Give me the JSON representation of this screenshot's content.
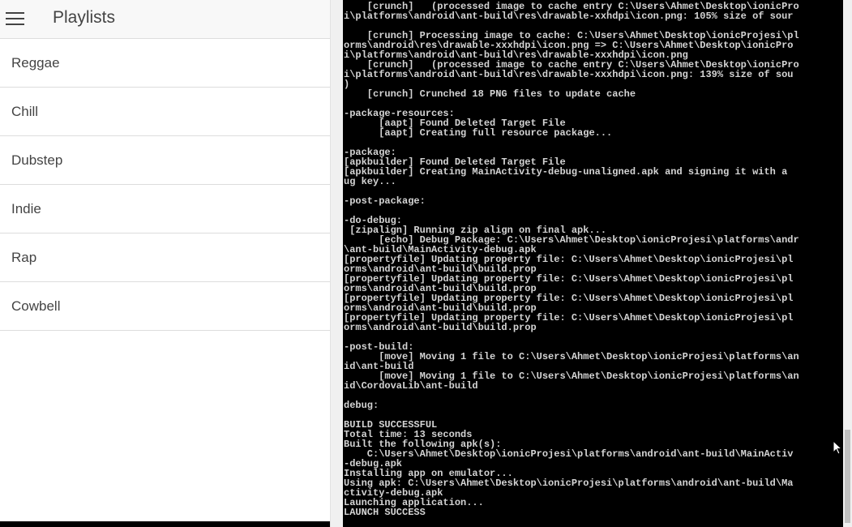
{
  "app": {
    "title": "Playlists",
    "menu_icon": "hamburger-menu-icon",
    "playlists": [
      {
        "label": "Reggae"
      },
      {
        "label": "Chill"
      },
      {
        "label": "Dubstep"
      },
      {
        "label": "Indie"
      },
      {
        "label": "Rap"
      },
      {
        "label": "Cowbell"
      }
    ]
  },
  "console": {
    "lines": [
      "    [crunch]   (processed image to cache entry C:\\Users\\Ahmet\\Desktop\\ionicPro",
      "i\\platforms\\android\\ant-build\\res\\drawable-xxhdpi\\icon.png: 105% size of sour",
      "",
      "    [crunch] Processing image to cache: C:\\Users\\Ahmet\\Desktop\\ionicProjesi\\pl",
      "orms\\android\\res\\drawable-xxxhdpi\\icon.png => C:\\Users\\Ahmet\\Desktop\\ionicPro",
      "i\\platforms\\android\\ant-build\\res\\drawable-xxxhdpi\\icon.png",
      "    [crunch]   (processed image to cache entry C:\\Users\\Ahmet\\Desktop\\ionicPro",
      "i\\platforms\\android\\ant-build\\res\\drawable-xxxhdpi\\icon.png: 139% size of sou",
      ")",
      "    [crunch] Crunched 18 PNG files to update cache",
      "",
      "-package-resources:",
      "      [aapt] Found Deleted Target File",
      "      [aapt] Creating full resource package...",
      "",
      "-package:",
      "[apkbuilder] Found Deleted Target File",
      "[apkbuilder] Creating MainActivity-debug-unaligned.apk and signing it with a",
      "ug key...",
      "",
      "-post-package:",
      "",
      "-do-debug:",
      " [zipalign] Running zip align on final apk...",
      "      [echo] Debug Package: C:\\Users\\Ahmet\\Desktop\\ionicProjesi\\platforms\\andr",
      "\\ant-build\\MainActivity-debug.apk",
      "[propertyfile] Updating property file: C:\\Users\\Ahmet\\Desktop\\ionicProjesi\\pl",
      "orms\\android\\ant-build\\build.prop",
      "[propertyfile] Updating property file: C:\\Users\\Ahmet\\Desktop\\ionicProjesi\\pl",
      "orms\\android\\ant-build\\build.prop",
      "[propertyfile] Updating property file: C:\\Users\\Ahmet\\Desktop\\ionicProjesi\\pl",
      "orms\\android\\ant-build\\build.prop",
      "[propertyfile] Updating property file: C:\\Users\\Ahmet\\Desktop\\ionicProjesi\\pl",
      "orms\\android\\ant-build\\build.prop",
      "",
      "-post-build:",
      "      [move] Moving 1 file to C:\\Users\\Ahmet\\Desktop\\ionicProjesi\\platforms\\an",
      "id\\ant-build",
      "      [move] Moving 1 file to C:\\Users\\Ahmet\\Desktop\\ionicProjesi\\platforms\\an",
      "id\\CordovaLib\\ant-build",
      "",
      "debug:",
      "",
      "BUILD SUCCESSFUL",
      "Total time: 13 seconds",
      "Built the following apk(s):",
      "    C:\\Users\\Ahmet\\Desktop\\ionicProjesi\\platforms\\android\\ant-build\\MainActiv",
      "-debug.apk",
      "Installing app on emulator...",
      "Using apk: C:\\Users\\Ahmet\\Desktop\\ionicProjesi\\platforms\\android\\ant-build\\Ma",
      "ctivity-debug.apk",
      "Launching application...",
      "LAUNCH SUCCESS"
    ],
    "text_color": "#d4d4d4",
    "background": "#000000"
  }
}
